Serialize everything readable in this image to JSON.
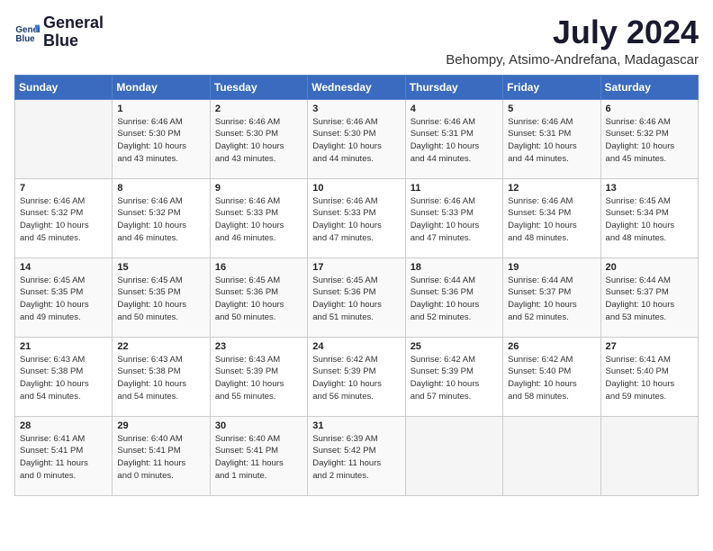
{
  "header": {
    "logo_line1": "General",
    "logo_line2": "Blue",
    "month": "July 2024",
    "location": "Behompy, Atsimo-Andrefana, Madagascar"
  },
  "days_of_week": [
    "Sunday",
    "Monday",
    "Tuesday",
    "Wednesday",
    "Thursday",
    "Friday",
    "Saturday"
  ],
  "weeks": [
    [
      {
        "day": "",
        "info": ""
      },
      {
        "day": "1",
        "info": "Sunrise: 6:46 AM\nSunset: 5:30 PM\nDaylight: 10 hours\nand 43 minutes."
      },
      {
        "day": "2",
        "info": "Sunrise: 6:46 AM\nSunset: 5:30 PM\nDaylight: 10 hours\nand 43 minutes."
      },
      {
        "day": "3",
        "info": "Sunrise: 6:46 AM\nSunset: 5:30 PM\nDaylight: 10 hours\nand 44 minutes."
      },
      {
        "day": "4",
        "info": "Sunrise: 6:46 AM\nSunset: 5:31 PM\nDaylight: 10 hours\nand 44 minutes."
      },
      {
        "day": "5",
        "info": "Sunrise: 6:46 AM\nSunset: 5:31 PM\nDaylight: 10 hours\nand 44 minutes."
      },
      {
        "day": "6",
        "info": "Sunrise: 6:46 AM\nSunset: 5:32 PM\nDaylight: 10 hours\nand 45 minutes."
      }
    ],
    [
      {
        "day": "7",
        "info": "Sunrise: 6:46 AM\nSunset: 5:32 PM\nDaylight: 10 hours\nand 45 minutes."
      },
      {
        "day": "8",
        "info": "Sunrise: 6:46 AM\nSunset: 5:32 PM\nDaylight: 10 hours\nand 46 minutes."
      },
      {
        "day": "9",
        "info": "Sunrise: 6:46 AM\nSunset: 5:33 PM\nDaylight: 10 hours\nand 46 minutes."
      },
      {
        "day": "10",
        "info": "Sunrise: 6:46 AM\nSunset: 5:33 PM\nDaylight: 10 hours\nand 47 minutes."
      },
      {
        "day": "11",
        "info": "Sunrise: 6:46 AM\nSunset: 5:33 PM\nDaylight: 10 hours\nand 47 minutes."
      },
      {
        "day": "12",
        "info": "Sunrise: 6:46 AM\nSunset: 5:34 PM\nDaylight: 10 hours\nand 48 minutes."
      },
      {
        "day": "13",
        "info": "Sunrise: 6:45 AM\nSunset: 5:34 PM\nDaylight: 10 hours\nand 48 minutes."
      }
    ],
    [
      {
        "day": "14",
        "info": "Sunrise: 6:45 AM\nSunset: 5:35 PM\nDaylight: 10 hours\nand 49 minutes."
      },
      {
        "day": "15",
        "info": "Sunrise: 6:45 AM\nSunset: 5:35 PM\nDaylight: 10 hours\nand 50 minutes."
      },
      {
        "day": "16",
        "info": "Sunrise: 6:45 AM\nSunset: 5:36 PM\nDaylight: 10 hours\nand 50 minutes."
      },
      {
        "day": "17",
        "info": "Sunrise: 6:45 AM\nSunset: 5:36 PM\nDaylight: 10 hours\nand 51 minutes."
      },
      {
        "day": "18",
        "info": "Sunrise: 6:44 AM\nSunset: 5:36 PM\nDaylight: 10 hours\nand 52 minutes."
      },
      {
        "day": "19",
        "info": "Sunrise: 6:44 AM\nSunset: 5:37 PM\nDaylight: 10 hours\nand 52 minutes."
      },
      {
        "day": "20",
        "info": "Sunrise: 6:44 AM\nSunset: 5:37 PM\nDaylight: 10 hours\nand 53 minutes."
      }
    ],
    [
      {
        "day": "21",
        "info": "Sunrise: 6:43 AM\nSunset: 5:38 PM\nDaylight: 10 hours\nand 54 minutes."
      },
      {
        "day": "22",
        "info": "Sunrise: 6:43 AM\nSunset: 5:38 PM\nDaylight: 10 hours\nand 54 minutes."
      },
      {
        "day": "23",
        "info": "Sunrise: 6:43 AM\nSunset: 5:39 PM\nDaylight: 10 hours\nand 55 minutes."
      },
      {
        "day": "24",
        "info": "Sunrise: 6:42 AM\nSunset: 5:39 PM\nDaylight: 10 hours\nand 56 minutes."
      },
      {
        "day": "25",
        "info": "Sunrise: 6:42 AM\nSunset: 5:39 PM\nDaylight: 10 hours\nand 57 minutes."
      },
      {
        "day": "26",
        "info": "Sunrise: 6:42 AM\nSunset: 5:40 PM\nDaylight: 10 hours\nand 58 minutes."
      },
      {
        "day": "27",
        "info": "Sunrise: 6:41 AM\nSunset: 5:40 PM\nDaylight: 10 hours\nand 59 minutes."
      }
    ],
    [
      {
        "day": "28",
        "info": "Sunrise: 6:41 AM\nSunset: 5:41 PM\nDaylight: 11 hours\nand 0 minutes."
      },
      {
        "day": "29",
        "info": "Sunrise: 6:40 AM\nSunset: 5:41 PM\nDaylight: 11 hours\nand 0 minutes."
      },
      {
        "day": "30",
        "info": "Sunrise: 6:40 AM\nSunset: 5:41 PM\nDaylight: 11 hours\nand 1 minute."
      },
      {
        "day": "31",
        "info": "Sunrise: 6:39 AM\nSunset: 5:42 PM\nDaylight: 11 hours\nand 2 minutes."
      },
      {
        "day": "",
        "info": ""
      },
      {
        "day": "",
        "info": ""
      },
      {
        "day": "",
        "info": ""
      }
    ]
  ]
}
